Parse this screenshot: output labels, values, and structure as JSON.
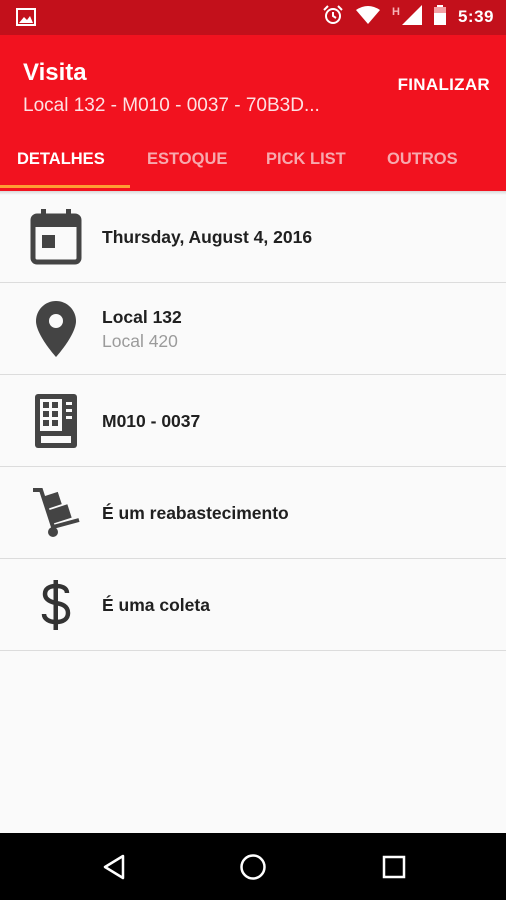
{
  "status_bar": {
    "time": "5:39",
    "network_label": "H",
    "icons": [
      "image-icon",
      "alarm-icon",
      "wifi-icon",
      "signal-icon",
      "battery-icon"
    ],
    "background": "#c3101b"
  },
  "app_bar": {
    "title": "Visita",
    "subtitle": "Local 132 - M010 - 0037 - 70B3D...",
    "action_label": "FINALIZAR",
    "background": "#f2121f",
    "tab_indicator_color": "#ff9d33"
  },
  "tabs": [
    {
      "label": "DETALHES",
      "active": true
    },
    {
      "label": "ESTOQUE",
      "active": false
    },
    {
      "label": "PICK LIST",
      "active": false
    },
    {
      "label": "OUTROS",
      "active": false
    }
  ],
  "details": [
    {
      "icon": "calendar-icon",
      "primary": "Thursday, August 4, 2016",
      "secondary": ""
    },
    {
      "icon": "location-pin-icon",
      "primary": "Local 132",
      "secondary": "Local 420"
    },
    {
      "icon": "vending-machine-icon",
      "primary": "M010 - 0037",
      "secondary": ""
    },
    {
      "icon": "hand-truck-icon",
      "primary": "É um reabastecimento",
      "secondary": ""
    },
    {
      "icon": "dollar-icon",
      "primary": "É uma coleta",
      "secondary": ""
    }
  ],
  "nav_bar": {
    "buttons": [
      "back-icon",
      "home-icon",
      "recents-icon"
    ]
  }
}
